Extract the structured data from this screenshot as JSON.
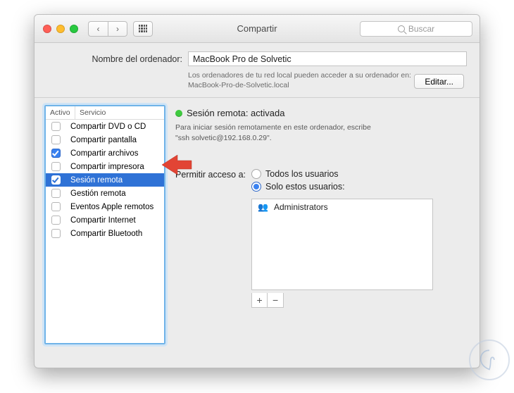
{
  "window": {
    "title": "Compartir",
    "search_placeholder": "Buscar"
  },
  "computer_name": {
    "label": "Nombre del ordenador:",
    "value": "MacBook Pro de Solvetic",
    "help_line1": "Los ordenadores de tu red local pueden acceder a su ordenador en:",
    "help_line2": "MacBook-Pro-de-Solvetic.local",
    "edit_button": "Editar..."
  },
  "services": {
    "header_active": "Activo",
    "header_service": "Servicio",
    "items": [
      {
        "label": "Compartir DVD o CD",
        "checked": false,
        "selected": false
      },
      {
        "label": "Compartir pantalla",
        "checked": false,
        "selected": false
      },
      {
        "label": "Compartir archivos",
        "checked": true,
        "selected": false
      },
      {
        "label": "Compartir impresora",
        "checked": false,
        "selected": false
      },
      {
        "label": "Sesión remota",
        "checked": true,
        "selected": true
      },
      {
        "label": "Gestión remota",
        "checked": false,
        "selected": false
      },
      {
        "label": "Eventos Apple remotos",
        "checked": false,
        "selected": false
      },
      {
        "label": "Compartir Internet",
        "checked": false,
        "selected": false
      },
      {
        "label": "Compartir Bluetooth",
        "checked": false,
        "selected": false
      }
    ]
  },
  "detail": {
    "status_title": "Sesión remota: activada",
    "instruction_line1": "Para iniciar sesión remotamente en este ordenador, escribe",
    "instruction_line2": "\"ssh solvetic@192.168.0.29\".",
    "access_label": "Permitir acceso a:",
    "radio_all": "Todos los usuarios",
    "radio_only": "Solo estos usuarios:",
    "users": [
      {
        "name": "Administrators"
      }
    ]
  }
}
